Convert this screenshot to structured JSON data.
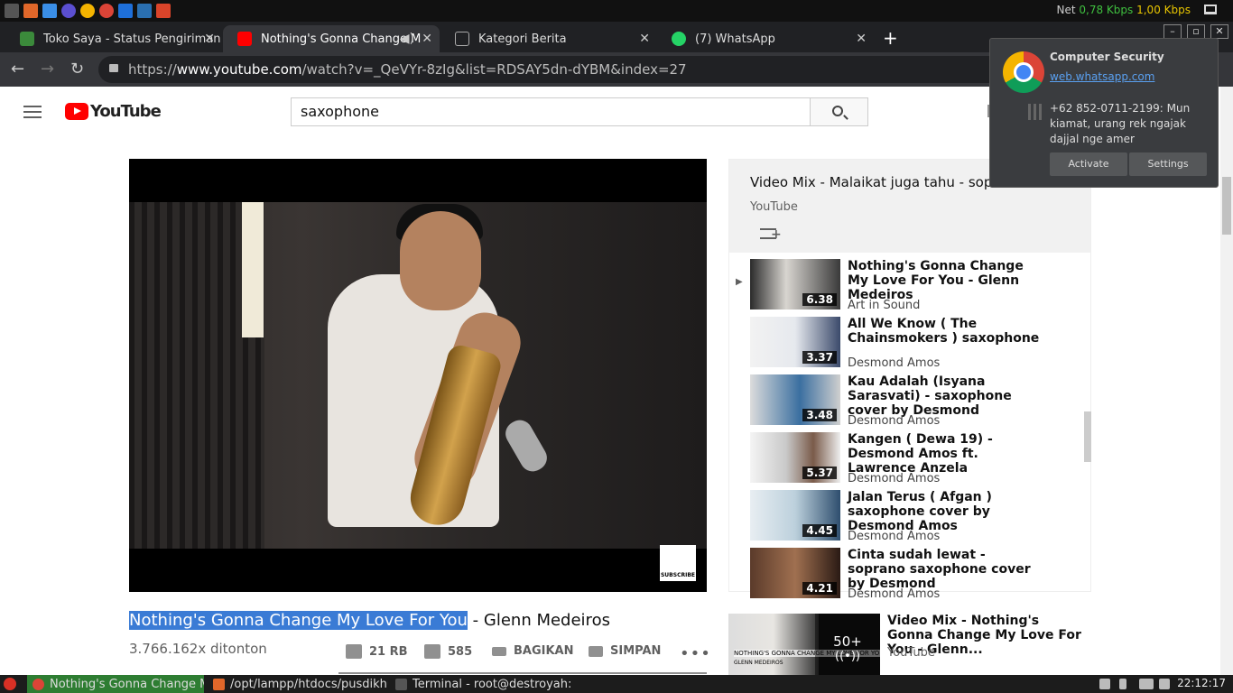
{
  "os_bar": {
    "net_label": "Net",
    "down": "0,78 Kbps",
    "up": "1,00 Kbps"
  },
  "tabs": [
    {
      "label": "Toko Saya - Status Pengiriman",
      "active": false
    },
    {
      "label": "Nothing's Gonna Change M",
      "active": true
    },
    {
      "label": "Kategori Berita",
      "active": false
    },
    {
      "label": "(7) WhatsApp",
      "active": false
    }
  ],
  "address": {
    "prefix": "https://",
    "host": "www.youtube.com",
    "path": "/watch?v=_QeVYr-8zIg&list=RDSAY5dn-dYBM&index=27"
  },
  "youtube": {
    "brand": "YouTube",
    "search_value": "saxophone"
  },
  "video": {
    "title_highlighted": "Nothing's Gonna Change My Love For You",
    "title_rest": " - Glenn Medeiros",
    "views": "3.766.162x ditonton",
    "likes": "21 RB",
    "dislikes": "585",
    "share": "BAGIKAN",
    "save": "SIMPAN",
    "subscribe_badge": "SUBSCRIBE"
  },
  "playlist": {
    "title": "Video Mix - Malaikat juga tahu - soprano",
    "owner": "YouTube",
    "items": [
      {
        "title": "Nothing's Gonna Change My Love For You - Glenn Medeiros",
        "channel": "Art in Sound",
        "duration": "6.38",
        "playing": true
      },
      {
        "title": "All We Know ( The Chainsmokers ) saxophone",
        "channel": "Desmond Amos",
        "duration": "3.37"
      },
      {
        "title": "Kau Adalah (Isyana Sarasvati) - saxophone cover by Desmond",
        "channel": "Desmond Amos",
        "duration": "3.48"
      },
      {
        "title": "Kangen ( Dewa 19) - Desmond Amos ft. Lawrence Anzela",
        "channel": "Desmond Amos",
        "duration": "5.37"
      },
      {
        "title": "Jalan Terus ( Afgan ) saxophone cover by Desmond Amos",
        "channel": "Desmond Amos",
        "duration": "4.45"
      },
      {
        "title": "Cinta sudah lewat - soprano saxophone cover by Desmond",
        "channel": "Desmond Amos",
        "duration": "4.21"
      }
    ]
  },
  "mix_card": {
    "title": "Video Mix - Nothing's Gonna Change My Love For You - Glenn...",
    "owner": "YouTube",
    "count": "50+",
    "thumb_caption": "NOTHING'S GONNA CHANGE MY LOVE FOR YOU",
    "thumb_sub": "GLENN MEDEIROS"
  },
  "notification": {
    "title": "Computer Security",
    "link": "web.whatsapp.com",
    "message": "+62 852-0711-2199: Mun kiamat, urang rek ngajak dajjal nge amer",
    "btn_activate": "Activate",
    "btn_settings": "Settings"
  },
  "taskbar": {
    "items": [
      {
        "label": "Nothing's Gonna Change M...",
        "active": true
      },
      {
        "label": "/opt/lampp/htdocs/pusdikhu...",
        "active": false
      },
      {
        "label": "Terminal - root@destroyah: ...",
        "active": false
      }
    ],
    "clock": "22:12:17"
  },
  "colors": {
    "yt_red": "#ff0000",
    "chrome_dark": "#202124",
    "highlight": "#3a7bd5"
  }
}
